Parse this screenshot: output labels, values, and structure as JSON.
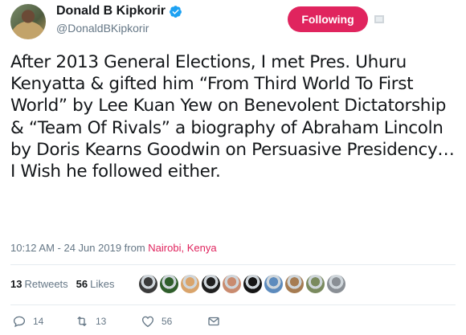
{
  "author": {
    "display_name": "Donald B Kipkorir",
    "handle": "@DonaldBKipkorir",
    "verified": true
  },
  "follow_button": {
    "label": "Following",
    "color": "#e0245e"
  },
  "tweet": {
    "text": "After 2013 General Elections, I met Pres. Uhuru Kenyatta & gifted him “From Third World To First World” by Lee Kuan Yew on Benevolent Dictatorship & “Team Of Rivals” a biography of Abraham Lincoln by Doris Kearns Goodwin on Persuasive Presidency… I Wish he followed either.",
    "timestamp": "10:12 AM - 24 Jun 2019 from",
    "location": "Nairobi, Kenya"
  },
  "stats": {
    "retweets_count": "13",
    "retweets_label": "Retweets",
    "likes_count": "56",
    "likes_label": "Likes"
  },
  "likers": [
    "#3b3b3b",
    "#2f5e2b",
    "#d9a46b",
    "#1f1f1f",
    "#c98b6f",
    "#151515",
    "#5d8bbd",
    "#a67c52",
    "#7a8a5e",
    "#8a8f95"
  ],
  "actions": {
    "reply_count": "14",
    "retweet_count": "13",
    "like_count": "56"
  },
  "colors": {
    "accent": "#e0245e",
    "verified": "#1da1f2",
    "muted": "#657786"
  }
}
